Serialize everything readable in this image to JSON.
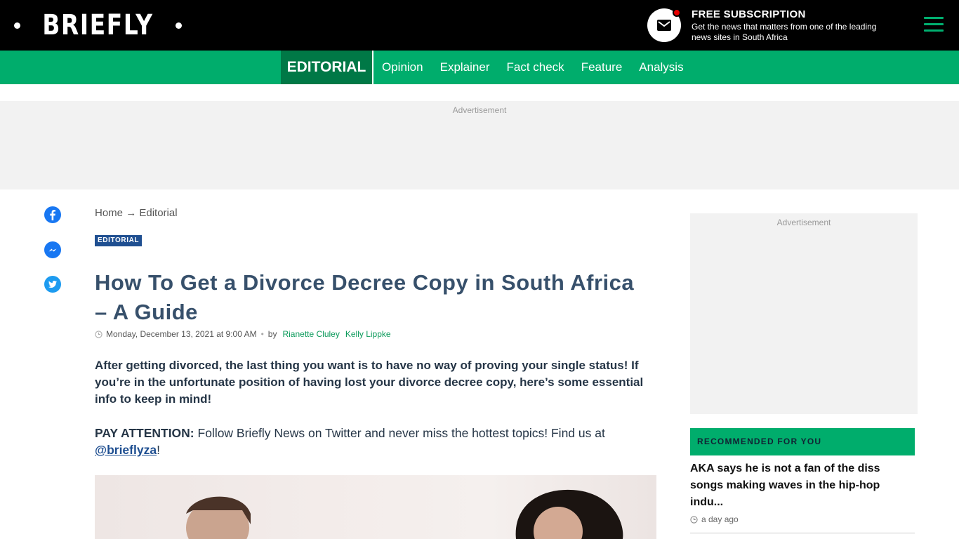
{
  "header": {
    "logo_text": "BRIEFLY",
    "subscription_title": "FREE SUBSCRIPTION",
    "subscription_desc": "Get the news that matters from one of the leading news sites in South Africa"
  },
  "nav": {
    "active": "EDITORIAL",
    "links": [
      "Opinion",
      "Explainer",
      "Fact check",
      "Feature",
      "Analysis"
    ],
    "accent": "#00ad6c",
    "active_bg": "#007846"
  },
  "ads": {
    "label": "Advertisement"
  },
  "article": {
    "breadcrumb": {
      "home": "Home",
      "sep": "→",
      "section": "Editorial"
    },
    "tag": "EDITORIAL",
    "title": "How To Get a Divorce Decree Copy in South Africa – A Guide",
    "date": "Monday, December 13, 2021 at 9:00 AM",
    "bullet": "•",
    "by": "by",
    "authors": [
      "Rianette Cluley",
      "Kelly Lippke"
    ],
    "lede": "After getting divorced, the last thing you want is to have no way of proving your single status! If you’re in the unfortunate position of having lost your divorce decree copy, here’s some essential info to keep in mind!",
    "pay_label": "PAY ATTENTION:",
    "pay_text": " Follow Briefly News on Twitter and never miss the hottest topics! Find us at ",
    "pay_link": "@brieflyza",
    "pay_end": "!"
  },
  "share_icons": [
    "facebook-icon",
    "messenger-icon",
    "twitter-icon"
  ],
  "sidebar": {
    "recommended_title": "RECOMMENDED FOR YOU",
    "items": [
      {
        "title": "AKA says he is not a fan of the diss songs making waves in the hip-hop indu...",
        "time": "a day ago"
      }
    ]
  }
}
